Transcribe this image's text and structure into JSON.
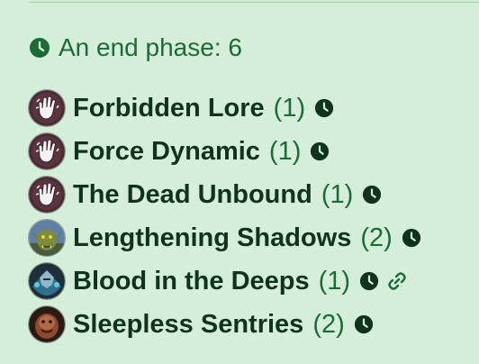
{
  "phase": {
    "label": "An end phase: 6",
    "icon": "clock-icon"
  },
  "cards": [
    {
      "name": "Forbidden Lore",
      "count": "(1)",
      "portrait": "psychic-hand-icon",
      "timed": true,
      "linked": false
    },
    {
      "name": "Force Dynamic",
      "count": "(1)",
      "portrait": "psychic-hand-icon",
      "timed": true,
      "linked": false
    },
    {
      "name": "The Dead Unbound",
      "count": "(1)",
      "portrait": "psychic-hand-icon",
      "timed": true,
      "linked": false
    },
    {
      "name": "Lengthening Shadows",
      "count": "(2)",
      "portrait": "goblin-portrait",
      "timed": true,
      "linked": false
    },
    {
      "name": "Blood in the Deeps",
      "count": "(1)",
      "portrait": "armored-warrior-portrait",
      "timed": true,
      "linked": true
    },
    {
      "name": "Sleepless Sentries",
      "count": "(2)",
      "portrait": "creature-portrait",
      "timed": true,
      "linked": false
    }
  ],
  "colors": {
    "background": "#d4eed9",
    "accent": "#1b6b35",
    "text": "#10331c"
  }
}
